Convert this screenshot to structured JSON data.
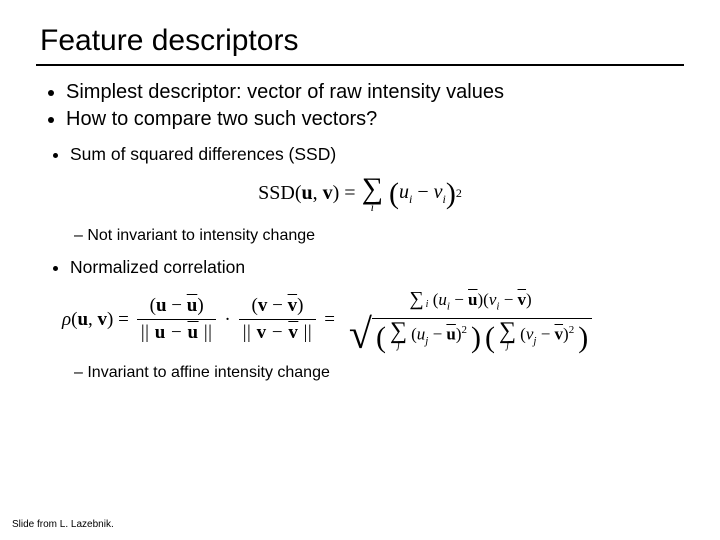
{
  "title": "Feature descriptors",
  "bullets": {
    "b1": "Simplest descriptor: vector of raw intensity values",
    "b2": "How to compare two such vectors?",
    "sub1": "Sum of squared differences (SSD)",
    "sub1_note": "Not invariant to intensity change",
    "sub2": "Normalized correlation",
    "sub2_note": "Invariant to affine intensity change"
  },
  "eq1": {
    "lhs": "SSD",
    "u": "u",
    "v": "v",
    "idx": "i"
  },
  "eq2": {
    "rho": "ρ",
    "u": "u",
    "v": "v",
    "idx_i": "i",
    "idx_j": "j"
  },
  "credit": "Slide from L. Lazebnik."
}
